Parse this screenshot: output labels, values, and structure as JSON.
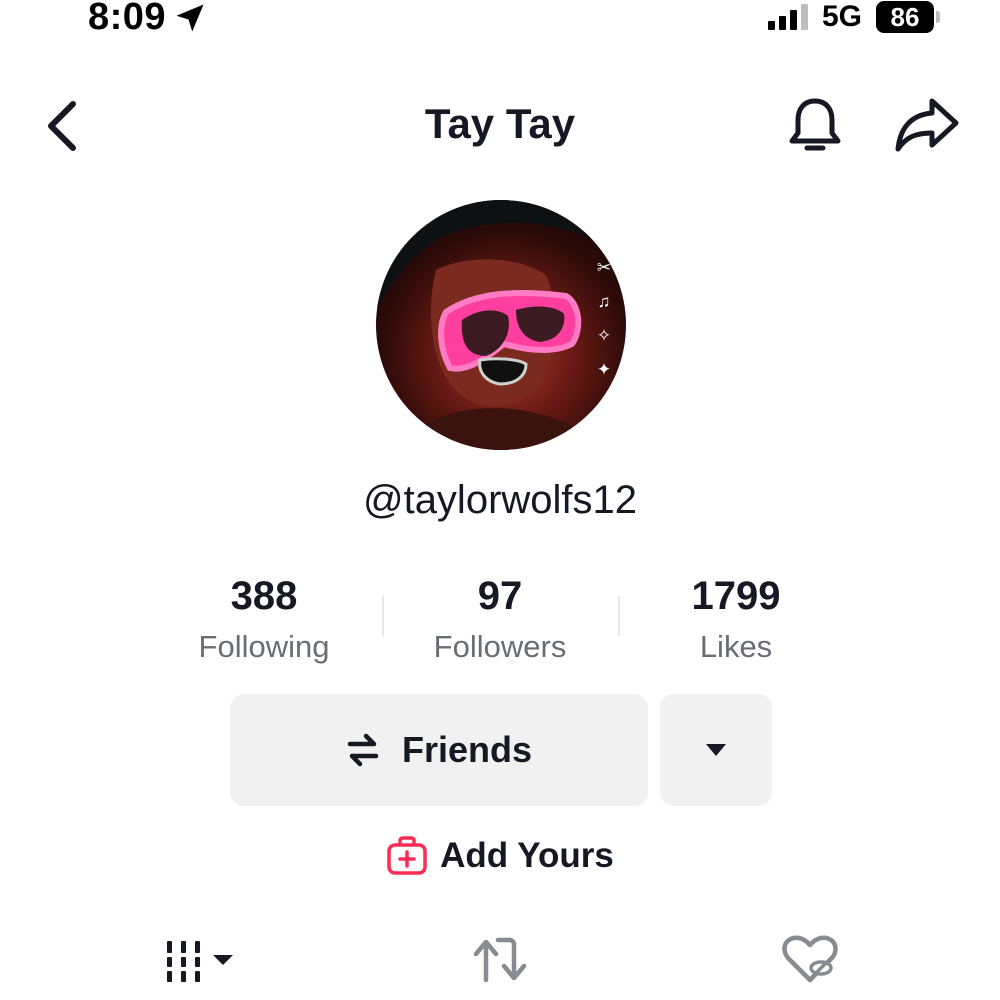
{
  "status_bar": {
    "time": "8:09",
    "network": "5G",
    "battery": "86",
    "icons": [
      "location-arrow-icon",
      "signal-icon",
      "battery-icon"
    ]
  },
  "header": {
    "title": "Tay Tay",
    "icons": [
      "chevron-left-icon",
      "bell-icon",
      "share-arrow-icon"
    ]
  },
  "profile": {
    "username": "@taylorwolfs12",
    "avatar_tools": [
      "scissors-icon",
      "music-note-icon",
      "search-sparkle-icon",
      "magic-wand-icon"
    ]
  },
  "stats": [
    {
      "value": "388",
      "label": "Following"
    },
    {
      "value": "97",
      "label": "Followers"
    },
    {
      "value": "1799",
      "label": "Likes"
    }
  ],
  "actions": {
    "friends_label": "Friends",
    "friends_icon": "swap-arrows-icon",
    "dropdown_icon": "caret-down-icon",
    "add_yours_label": "Add Yours",
    "add_yours_icon": "add-yours-icon"
  },
  "tabs": [
    {
      "icon": "videos-grid-icon"
    },
    {
      "icon": "repost-icon"
    },
    {
      "icon": "liked-hidden-icon"
    }
  ],
  "colors": {
    "text": "#161823",
    "secondary_text": "#6b6d75",
    "button_bg": "#f1f1f2",
    "accent_red": "#fe2c55"
  }
}
